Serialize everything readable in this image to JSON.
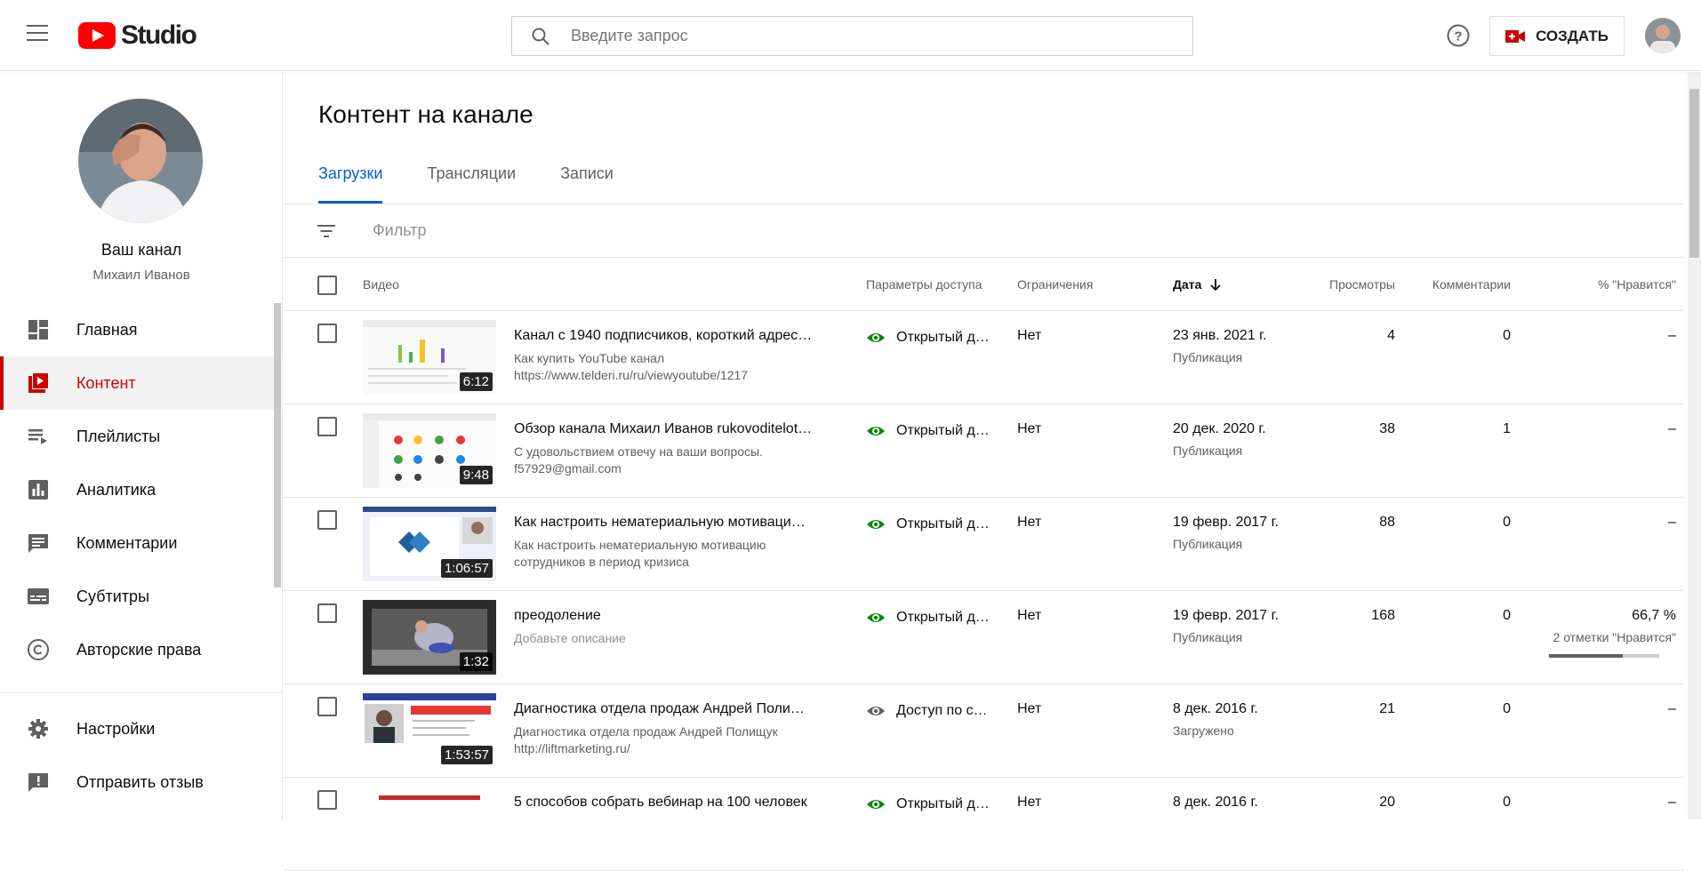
{
  "header": {
    "logo_text": "Studio",
    "search_placeholder": "Введите запрос",
    "create_label": "СОЗДАТЬ"
  },
  "sidebar": {
    "channel_title": "Ваш канал",
    "channel_name": "Михаил Иванов",
    "items": [
      {
        "label": "Главная",
        "icon": "dashboard-icon"
      },
      {
        "label": "Контент",
        "icon": "content-icon",
        "active": true
      },
      {
        "label": "Плейлисты",
        "icon": "playlist-icon"
      },
      {
        "label": "Аналитика",
        "icon": "analytics-icon"
      },
      {
        "label": "Комментарии",
        "icon": "comments-icon"
      },
      {
        "label": "Субтитры",
        "icon": "subtitles-icon"
      },
      {
        "label": "Авторские права",
        "icon": "copyright-icon"
      }
    ],
    "bottom_items": [
      {
        "label": "Настройки",
        "icon": "gear-icon"
      },
      {
        "label": "Отправить отзыв",
        "icon": "feedback-icon"
      }
    ]
  },
  "main": {
    "title": "Контент на канале",
    "tabs": [
      {
        "label": "Загрузки",
        "active": true
      },
      {
        "label": "Трансляции"
      },
      {
        "label": "Записи"
      }
    ],
    "filter_placeholder": "Фильтр",
    "columns": {
      "video": "Видео",
      "visibility": "Параметры доступа",
      "restrictions": "Ограничения",
      "date": "Дата",
      "views": "Просмотры",
      "comments": "Комментарии",
      "likes": "% \"Нравится\""
    },
    "rows": [
      {
        "title": "Канал с 1940 подписчиков, короткий адрес…",
        "desc": "Как купить YouTube канал https://www.telderi.ru/ru/viewyoutube/1217",
        "duration": "6:12",
        "visibility": "Открытый д…",
        "restrictions": "Нет",
        "date": "23 янв. 2021 г.",
        "status": "Публикация",
        "views": "4",
        "comments": "0",
        "likes": "–",
        "likes_sub": ""
      },
      {
        "title": "Обзор канала Михаил Иванов rukovoditelot…",
        "desc": "С удовольствием отвечу на ваши вопросы. f57929@gmail.com",
        "duration": "9:48",
        "visibility": "Открытый д…",
        "restrictions": "Нет",
        "date": "20 дек. 2020 г.",
        "status": "Публикация",
        "views": "38",
        "comments": "1",
        "likes": "–",
        "likes_sub": ""
      },
      {
        "title": "Как настроить нематериальную мотиваци…",
        "desc": "Как настроить нематериальную мотивацию сотрудников в период кризиса",
        "duration": "1:06:57",
        "visibility": "Открытый д…",
        "restrictions": "Нет",
        "date": "19 февр. 2017 г.",
        "status": "Публикация",
        "views": "88",
        "comments": "0",
        "likes": "–",
        "likes_sub": ""
      },
      {
        "title": "преодоление",
        "desc": "Добавьте описание",
        "duration": "1:32",
        "visibility": "Открытый д…",
        "restrictions": "Нет",
        "date": "19 февр. 2017 г.",
        "status": "Публикация",
        "views": "168",
        "comments": "0",
        "likes": "66,7 %",
        "likes_sub": "2 отметки \"Нравится\"",
        "likes_fraction": 0.667
      },
      {
        "title": "Диагностика отдела продаж Андрей Поли…",
        "desc": "Диагностика отдела продаж Андрей Полищук http://liftmarketing.ru/",
        "duration": "1:53:57",
        "visibility": "Доступ по с…",
        "restrictions": "Нет",
        "date": "8 дек. 2016 г.",
        "status": "Загружено",
        "views": "21",
        "comments": "0",
        "likes": "–",
        "likes_sub": ""
      },
      {
        "title": "5 способов собрать вебинар на 100 человек",
        "desc": "",
        "duration": "",
        "visibility": "Открытый д…",
        "restrictions": "Нет",
        "date": "8 дек. 2016 г.",
        "status": "",
        "views": "20",
        "comments": "0",
        "likes": "–",
        "likes_sub": ""
      }
    ]
  },
  "colors": {
    "accent_red": "#cc0000",
    "tab_blue": "#065fd4",
    "public_green": "#0a8a0a",
    "unlisted_gray": "#606060"
  }
}
